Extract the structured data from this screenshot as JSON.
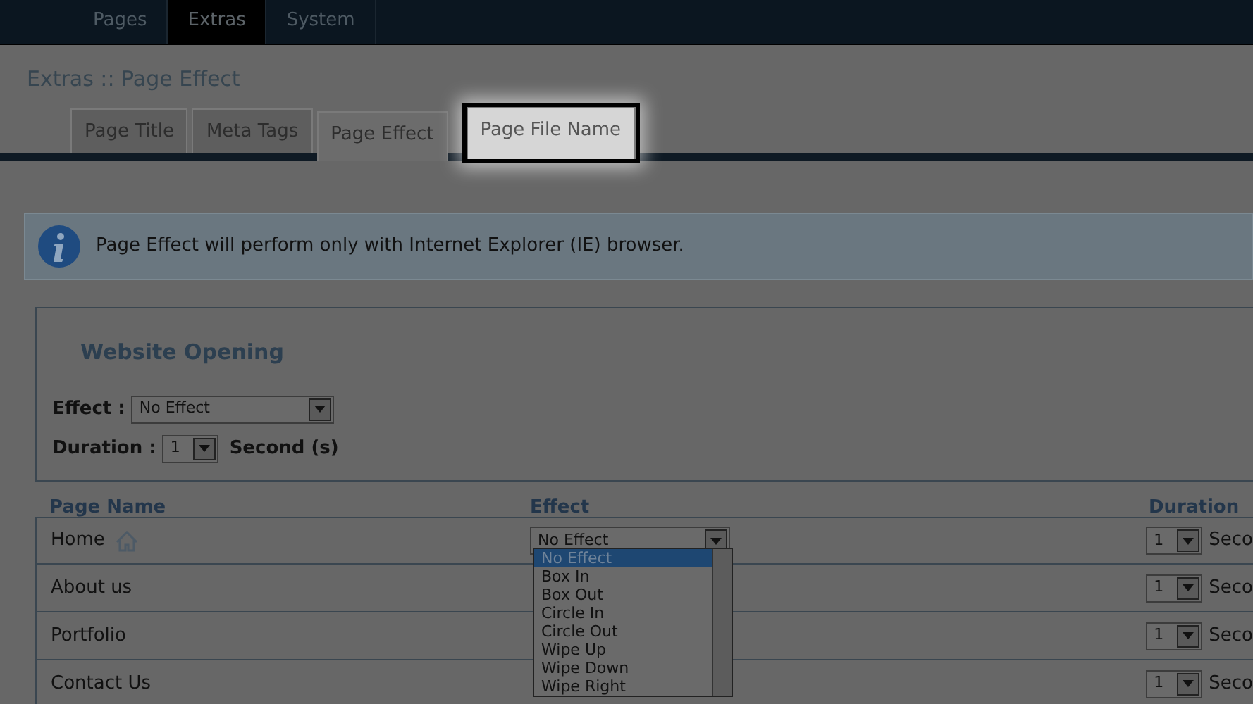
{
  "top_nav": [
    {
      "label": "Pages",
      "selected": false
    },
    {
      "label": "Extras",
      "selected": true
    },
    {
      "label": "System",
      "selected": false
    }
  ],
  "breadcrumb": "Extras :: Page Effect",
  "tabs": [
    {
      "label": "Page Title",
      "selected": false,
      "highlighted": false
    },
    {
      "label": "Meta Tags",
      "selected": false,
      "highlighted": false
    },
    {
      "label": "Page Effect",
      "selected": true,
      "highlighted": false
    },
    {
      "label": "Page File Name",
      "selected": false,
      "highlighted": true
    }
  ],
  "info": "Page Effect will perform only with Internet Explorer (IE) browser.",
  "website_opening": {
    "title": "Website Opening",
    "effect_label": "Effect :",
    "effect_value": "No Effect",
    "duration_label": "Duration :",
    "duration_value": "1",
    "unit": "Second (s)"
  },
  "table": {
    "columns": [
      "Page Name",
      "Effect",
      "Duration"
    ],
    "rows": [
      {
        "page": "Home",
        "kind": "home",
        "effect": "No Effect",
        "duration": "1",
        "unit": "Seco"
      },
      {
        "page": "About us",
        "duration": "1",
        "unit": "Seco"
      },
      {
        "page": "Portfolio",
        "duration": "1",
        "unit": "Seco"
      },
      {
        "page": "Contact Us",
        "duration": "1",
        "unit": "Seco"
      }
    ]
  },
  "dropdown": {
    "options": [
      {
        "label": "No Effect",
        "selected": true
      },
      {
        "label": "Box In",
        "selected": false
      },
      {
        "label": "Box Out",
        "selected": false
      },
      {
        "label": "Circle In",
        "selected": false
      },
      {
        "label": "Circle Out",
        "selected": false
      },
      {
        "label": "Wipe Up",
        "selected": false
      },
      {
        "label": "Wipe Down",
        "selected": false
      },
      {
        "label": "Wipe Right",
        "selected": false
      }
    ]
  }
}
